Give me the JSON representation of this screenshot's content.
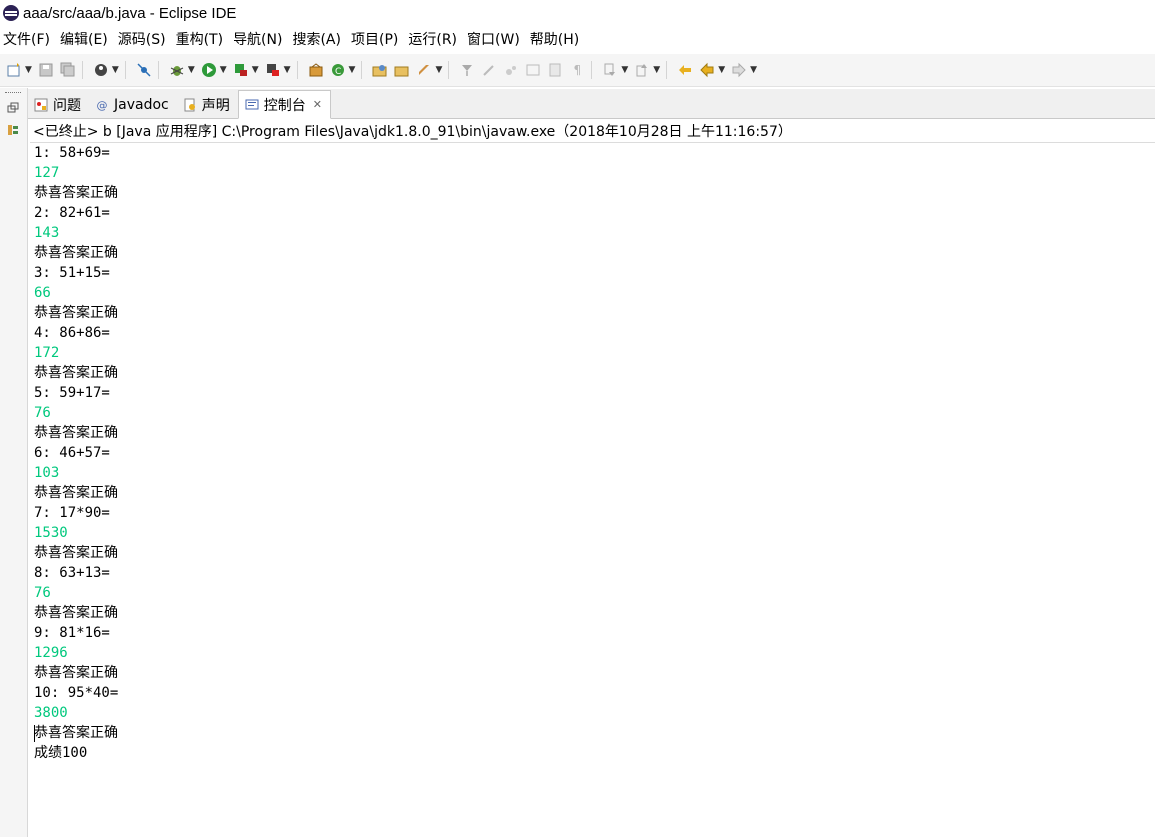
{
  "window": {
    "title": "aaa/src/aaa/b.java - Eclipse IDE"
  },
  "menubar": {
    "items": [
      {
        "label": "文件(F)"
      },
      {
        "label": "编辑(E)"
      },
      {
        "label": "源码(S)"
      },
      {
        "label": "重构(T)"
      },
      {
        "label": "导航(N)"
      },
      {
        "label": "搜索(A)"
      },
      {
        "label": "项目(P)"
      },
      {
        "label": "运行(R)"
      },
      {
        "label": "窗口(W)"
      },
      {
        "label": "帮助(H)"
      }
    ]
  },
  "toolbar": {
    "icons": [
      "new-icon",
      "save-icon",
      "save-all-icon",
      "profile-icon",
      "skip-breakpoints-icon",
      "debug-icon",
      "run-icon",
      "coverage-icon",
      "external-tools-icon",
      "new-java-project-icon",
      "new-class-icon",
      "open-type-icon",
      "open-task-icon",
      "search-icon",
      "toggle-mark-icon",
      "toggle-block-icon",
      "word-wrap-icon",
      "show-whitespace-icon",
      "pilcrow-icon",
      "next-annotation-icon",
      "prev-annotation-icon",
      "last-edit-icon",
      "back-icon",
      "forward-icon"
    ]
  },
  "tabs": [
    {
      "label": "问题",
      "icon": "problems-icon",
      "active": false
    },
    {
      "label": "Javadoc",
      "icon": "javadoc-icon",
      "active": false
    },
    {
      "label": "声明",
      "icon": "declaration-icon",
      "active": false
    },
    {
      "label": "控制台",
      "icon": "console-icon",
      "active": true
    }
  ],
  "console": {
    "header": "<已终止> b [Java 应用程序] C:\\Program Files\\Java\\jdk1.8.0_91\\bin\\javaw.exe（2018年10月28日 上午11:16:57）",
    "colors": {
      "input": "#00c87d",
      "output": "#000000"
    },
    "lines": [
      {
        "text": "1: 58+69=",
        "type": "output"
      },
      {
        "text": "127",
        "type": "input"
      },
      {
        "text": "恭喜答案正确",
        "type": "output"
      },
      {
        "text": "2: 82+61=",
        "type": "output"
      },
      {
        "text": "143",
        "type": "input"
      },
      {
        "text": "恭喜答案正确",
        "type": "output"
      },
      {
        "text": "3: 51+15=",
        "type": "output"
      },
      {
        "text": "66",
        "type": "input"
      },
      {
        "text": "恭喜答案正确",
        "type": "output"
      },
      {
        "text": "4: 86+86=",
        "type": "output"
      },
      {
        "text": "172",
        "type": "input"
      },
      {
        "text": "恭喜答案正确",
        "type": "output"
      },
      {
        "text": "5: 59+17=",
        "type": "output"
      },
      {
        "text": "76",
        "type": "input"
      },
      {
        "text": "恭喜答案正确",
        "type": "output"
      },
      {
        "text": "6: 46+57=",
        "type": "output"
      },
      {
        "text": "103",
        "type": "input"
      },
      {
        "text": "恭喜答案正确",
        "type": "output"
      },
      {
        "text": "7: 17*90=",
        "type": "output"
      },
      {
        "text": "1530",
        "type": "input"
      },
      {
        "text": "恭喜答案正确",
        "type": "output"
      },
      {
        "text": "8: 63+13=",
        "type": "output"
      },
      {
        "text": "76",
        "type": "input"
      },
      {
        "text": "恭喜答案正确",
        "type": "output"
      },
      {
        "text": "9: 81*16=",
        "type": "output"
      },
      {
        "text": "1296",
        "type": "input"
      },
      {
        "text": "恭喜答案正确",
        "type": "output"
      },
      {
        "text": "10: 95*40=",
        "type": "output"
      },
      {
        "text": "3800",
        "type": "input"
      },
      {
        "text": "恭喜答案正确",
        "type": "output"
      },
      {
        "text": "成绩100",
        "type": "output"
      }
    ]
  }
}
